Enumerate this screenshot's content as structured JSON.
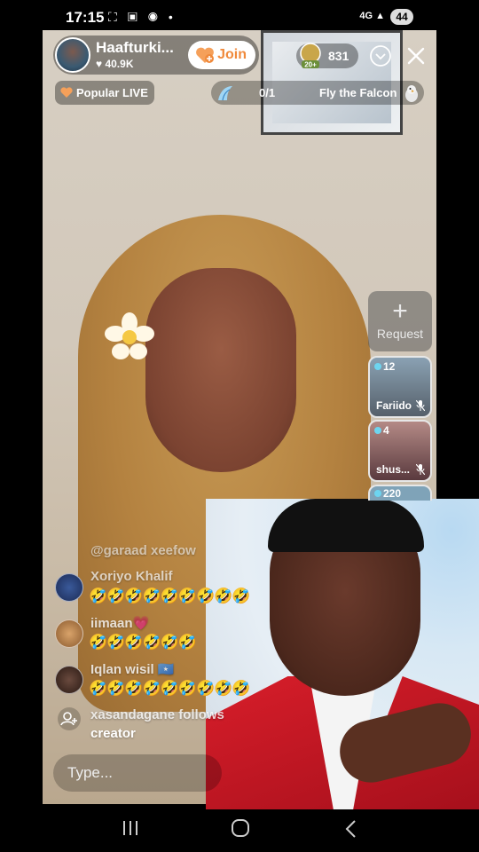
{
  "status_bar": {
    "time": "17:15",
    "icons": "⛶ ▣ ◉ •",
    "network": "4G",
    "signal": "▲",
    "battery": "44"
  },
  "host": {
    "name": "Haafturki...",
    "likes": "♥ 40.9K",
    "join_label": "Join"
  },
  "viewers": {
    "badge_level": "20+",
    "count": "831"
  },
  "badges": {
    "popular_label": "Popular LIVE",
    "falcon_progress": "0/1",
    "falcon_label": "Fly the Falcon"
  },
  "guest_panel": {
    "request_plus": "+",
    "request_label": "Request",
    "tiles": [
      {
        "count": "12",
        "name": "Fariido"
      },
      {
        "count": "4",
        "name": "shus..."
      },
      {
        "count": "220",
        "name": ""
      }
    ]
  },
  "chat": {
    "mention": "@garaad xeefow",
    "messages": [
      {
        "user": "Xoriyo Khalif",
        "text": "🤣🤣🤣🤣🤣🤣🤣🤣🤣"
      },
      {
        "user": "iimaan💗",
        "text": "🤣🤣🤣🤣🤣🤣"
      },
      {
        "user": "Iqlan  wisil 🇸🇴",
        "text": "🤣🤣🤣🤣🤣🤣🤣🤣🤣"
      }
    ],
    "follow_user": "xasandagane",
    "follow_text": "follows",
    "follow_text_2": "creator",
    "type_placeholder": "Type..."
  },
  "colors": {
    "join_text": "#f08a3c",
    "request_bg": "#5a5a5a",
    "tile_dot": "#6dd5f0"
  }
}
